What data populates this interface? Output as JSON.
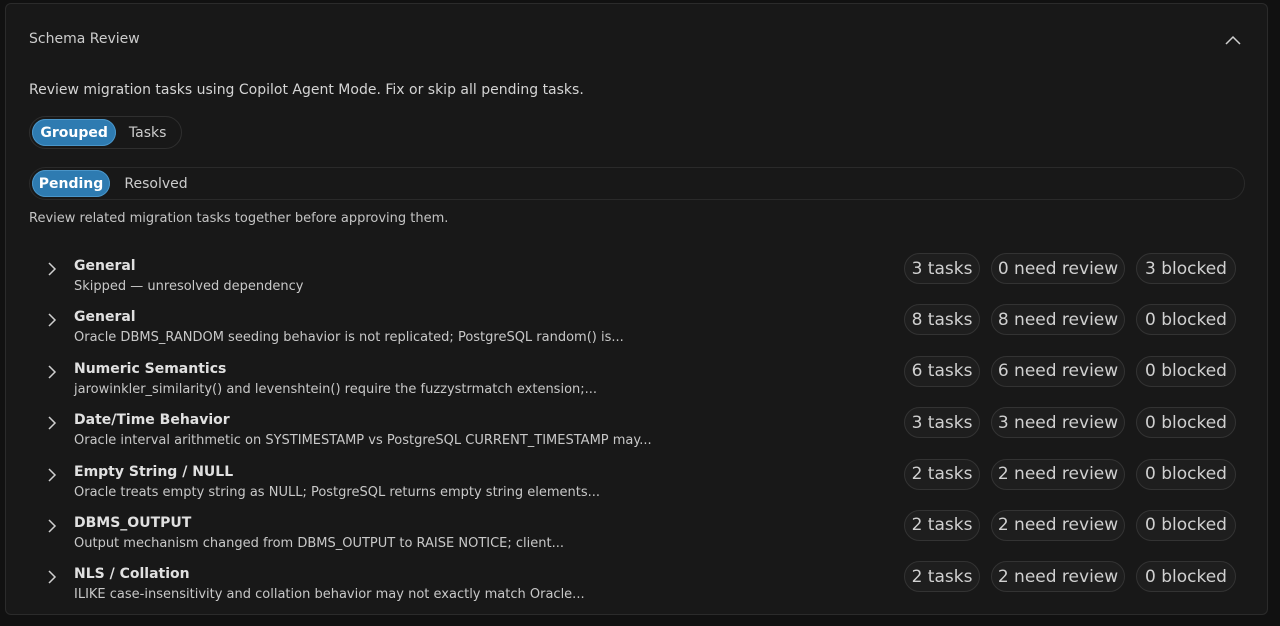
{
  "panel": {
    "title": "Schema Review",
    "intro": "Review migration tasks using Copilot Agent Mode. Fix or skip all pending tasks.",
    "help": "Review related migration tasks together before approving them."
  },
  "view_toggle": {
    "grouped": "Grouped",
    "tasks": "Tasks",
    "selected": "Grouped"
  },
  "status_filter": {
    "pending": "Pending",
    "resolved": "Resolved",
    "selected": "Pending"
  },
  "groups": [
    {
      "title": "General",
      "desc": "Skipped — unresolved dependency",
      "tasks": "3 tasks",
      "review": "0 need review",
      "blocked": "3 blocked"
    },
    {
      "title": "General",
      "desc": "Oracle DBMS_RANDOM seeding behavior is not replicated; PostgreSQL random() is...",
      "tasks": "8 tasks",
      "review": "8 need review",
      "blocked": "0 blocked"
    },
    {
      "title": "Numeric Semantics",
      "desc": "jarowinkler_similarity() and levenshtein() require the fuzzystrmatch extension;...",
      "tasks": "6 tasks",
      "review": "6 need review",
      "blocked": "0 blocked"
    },
    {
      "title": "Date/Time Behavior",
      "desc": "Oracle interval arithmetic on SYSTIMESTAMP vs PostgreSQL CURRENT_TIMESTAMP may...",
      "tasks": "3 tasks",
      "review": "3 need review",
      "blocked": "0 blocked"
    },
    {
      "title": "Empty String / NULL",
      "desc": "Oracle treats empty string as NULL; PostgreSQL returns empty string elements...",
      "tasks": "2 tasks",
      "review": "2 need review",
      "blocked": "0 blocked"
    },
    {
      "title": "DBMS_OUTPUT",
      "desc": "Output mechanism changed from DBMS_OUTPUT to RAISE NOTICE; client...",
      "tasks": "2 tasks",
      "review": "2 need review",
      "blocked": "0 blocked"
    },
    {
      "title": "NLS / Collation",
      "desc": "ILIKE case-insensitivity and collation behavior may not exactly match Oracle...",
      "tasks": "2 tasks",
      "review": "2 need review",
      "blocked": "0 blocked"
    }
  ],
  "colors": {
    "accent": "#2e7bb1",
    "panel_bg": "#181818",
    "page_bg": "#111111"
  }
}
